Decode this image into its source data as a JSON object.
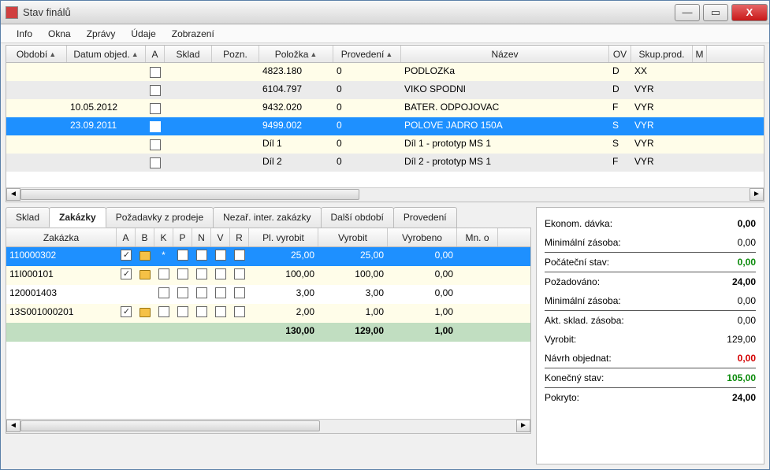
{
  "window": {
    "title": "Stav finálů"
  },
  "menu": [
    "Info",
    "Okna",
    "Zprávy",
    "Údaje",
    "Zobrazení"
  ],
  "upper_headers": {
    "obdobi": "Období",
    "datum": "Datum objed.",
    "a": "A",
    "sklad": "Sklad",
    "pozn": "Pozn.",
    "polozka": "Položka",
    "provedeni": "Provedení",
    "nazev": "Název",
    "ov": "OV",
    "skup": "Skup.prod.",
    "m": "M"
  },
  "upper_rows": [
    {
      "stripe": 0,
      "datum": "",
      "polozka": "4823.180",
      "prov": "0",
      "nazev": "PODLOZKa",
      "ov": "D",
      "skp": "XX"
    },
    {
      "stripe": 1,
      "datum": "",
      "polozka": "6104.797",
      "prov": "0",
      "nazev": "VIKO SPODNI",
      "ov": "D",
      "skp": "VYR"
    },
    {
      "stripe": 0,
      "datum": "10.05.2012",
      "polozka": "9432.020",
      "prov": "0",
      "nazev": "BATER. ODPOJOVAC",
      "ov": "F",
      "skp": "VYR"
    },
    {
      "stripe": 1,
      "sel": true,
      "datum": "23.09.2011",
      "polozka": "9499.002",
      "prov": "0",
      "nazev": "POLOVE JADRO 150A",
      "ov": "S",
      "skp": "VYR"
    },
    {
      "stripe": 0,
      "datum": "",
      "polozka": "Díl 1",
      "prov": "0",
      "nazev": "Díl 1 - prototyp MS 1",
      "ov": "S",
      "skp": "VYR"
    },
    {
      "stripe": 1,
      "datum": "",
      "polozka": "Díl 2",
      "prov": "0",
      "nazev": "Díl 2 - prototyp MS 1",
      "ov": "F",
      "skp": "VYR"
    }
  ],
  "tabs": [
    "Sklad",
    "Zakázky",
    "Požadavky z prodeje",
    "Nezař. inter. zakázky",
    "Další období",
    "Provedení"
  ],
  "active_tab": 1,
  "lower_headers": {
    "zakazka": "Zakázka",
    "a": "A",
    "b": "B",
    "k": "K",
    "p": "P",
    "n": "N",
    "v": "V",
    "r": "R",
    "plv": "Pl. vyrobit",
    "vyrobit": "Vyrobit",
    "vyrobeno": "Vyrobeno",
    "mno": "Mn. o"
  },
  "lower_rows": [
    {
      "sel": true,
      "zak": "110000302",
      "a_chk": true,
      "b_ico": true,
      "k": "*",
      "plv": "25,00",
      "vyr": "25,00",
      "vyro": "0,00"
    },
    {
      "stripe": 0,
      "zak": "11I000101",
      "a_chk": true,
      "b_ico": true,
      "plv": "100,00",
      "vyr": "100,00",
      "vyro": "0,00"
    },
    {
      "stripe": 1,
      "zak": "120001403",
      "plv": "3,00",
      "vyr": "3,00",
      "vyro": "0,00"
    },
    {
      "stripe": 0,
      "zak": "13S001000201",
      "a_chk": true,
      "b_ico": true,
      "plv": "2,00",
      "vyr": "1,00",
      "vyro": "1,00"
    }
  ],
  "lower_total": {
    "plv": "130,00",
    "vyr": "129,00",
    "vyro": "1,00"
  },
  "info": [
    {
      "label": "Ekonom. dávka:",
      "value": "0,00",
      "bold": true
    },
    {
      "label": "Minimální zásoba:",
      "value": "0,00",
      "divider": true
    },
    {
      "label": "Počáteční stav:",
      "value": "0,00",
      "color": "green",
      "divider": true
    },
    {
      "label": "Požadováno:",
      "value": "24,00",
      "bold": true
    },
    {
      "label": "Minimální zásoba:",
      "value": "0,00",
      "divider": true
    },
    {
      "label": "Akt. sklad. zásoba:",
      "value": "0,00"
    },
    {
      "label": "Vyrobit:",
      "value": "129,00"
    },
    {
      "label": "Návrh objednat:",
      "value": "0,00",
      "color": "red",
      "bold": true,
      "divider": true
    },
    {
      "label": "Konečný stav:",
      "value": "105,00",
      "color": "green",
      "divider": true
    },
    {
      "label": "Pokryto:",
      "value": "24,00",
      "bold": true
    }
  ]
}
